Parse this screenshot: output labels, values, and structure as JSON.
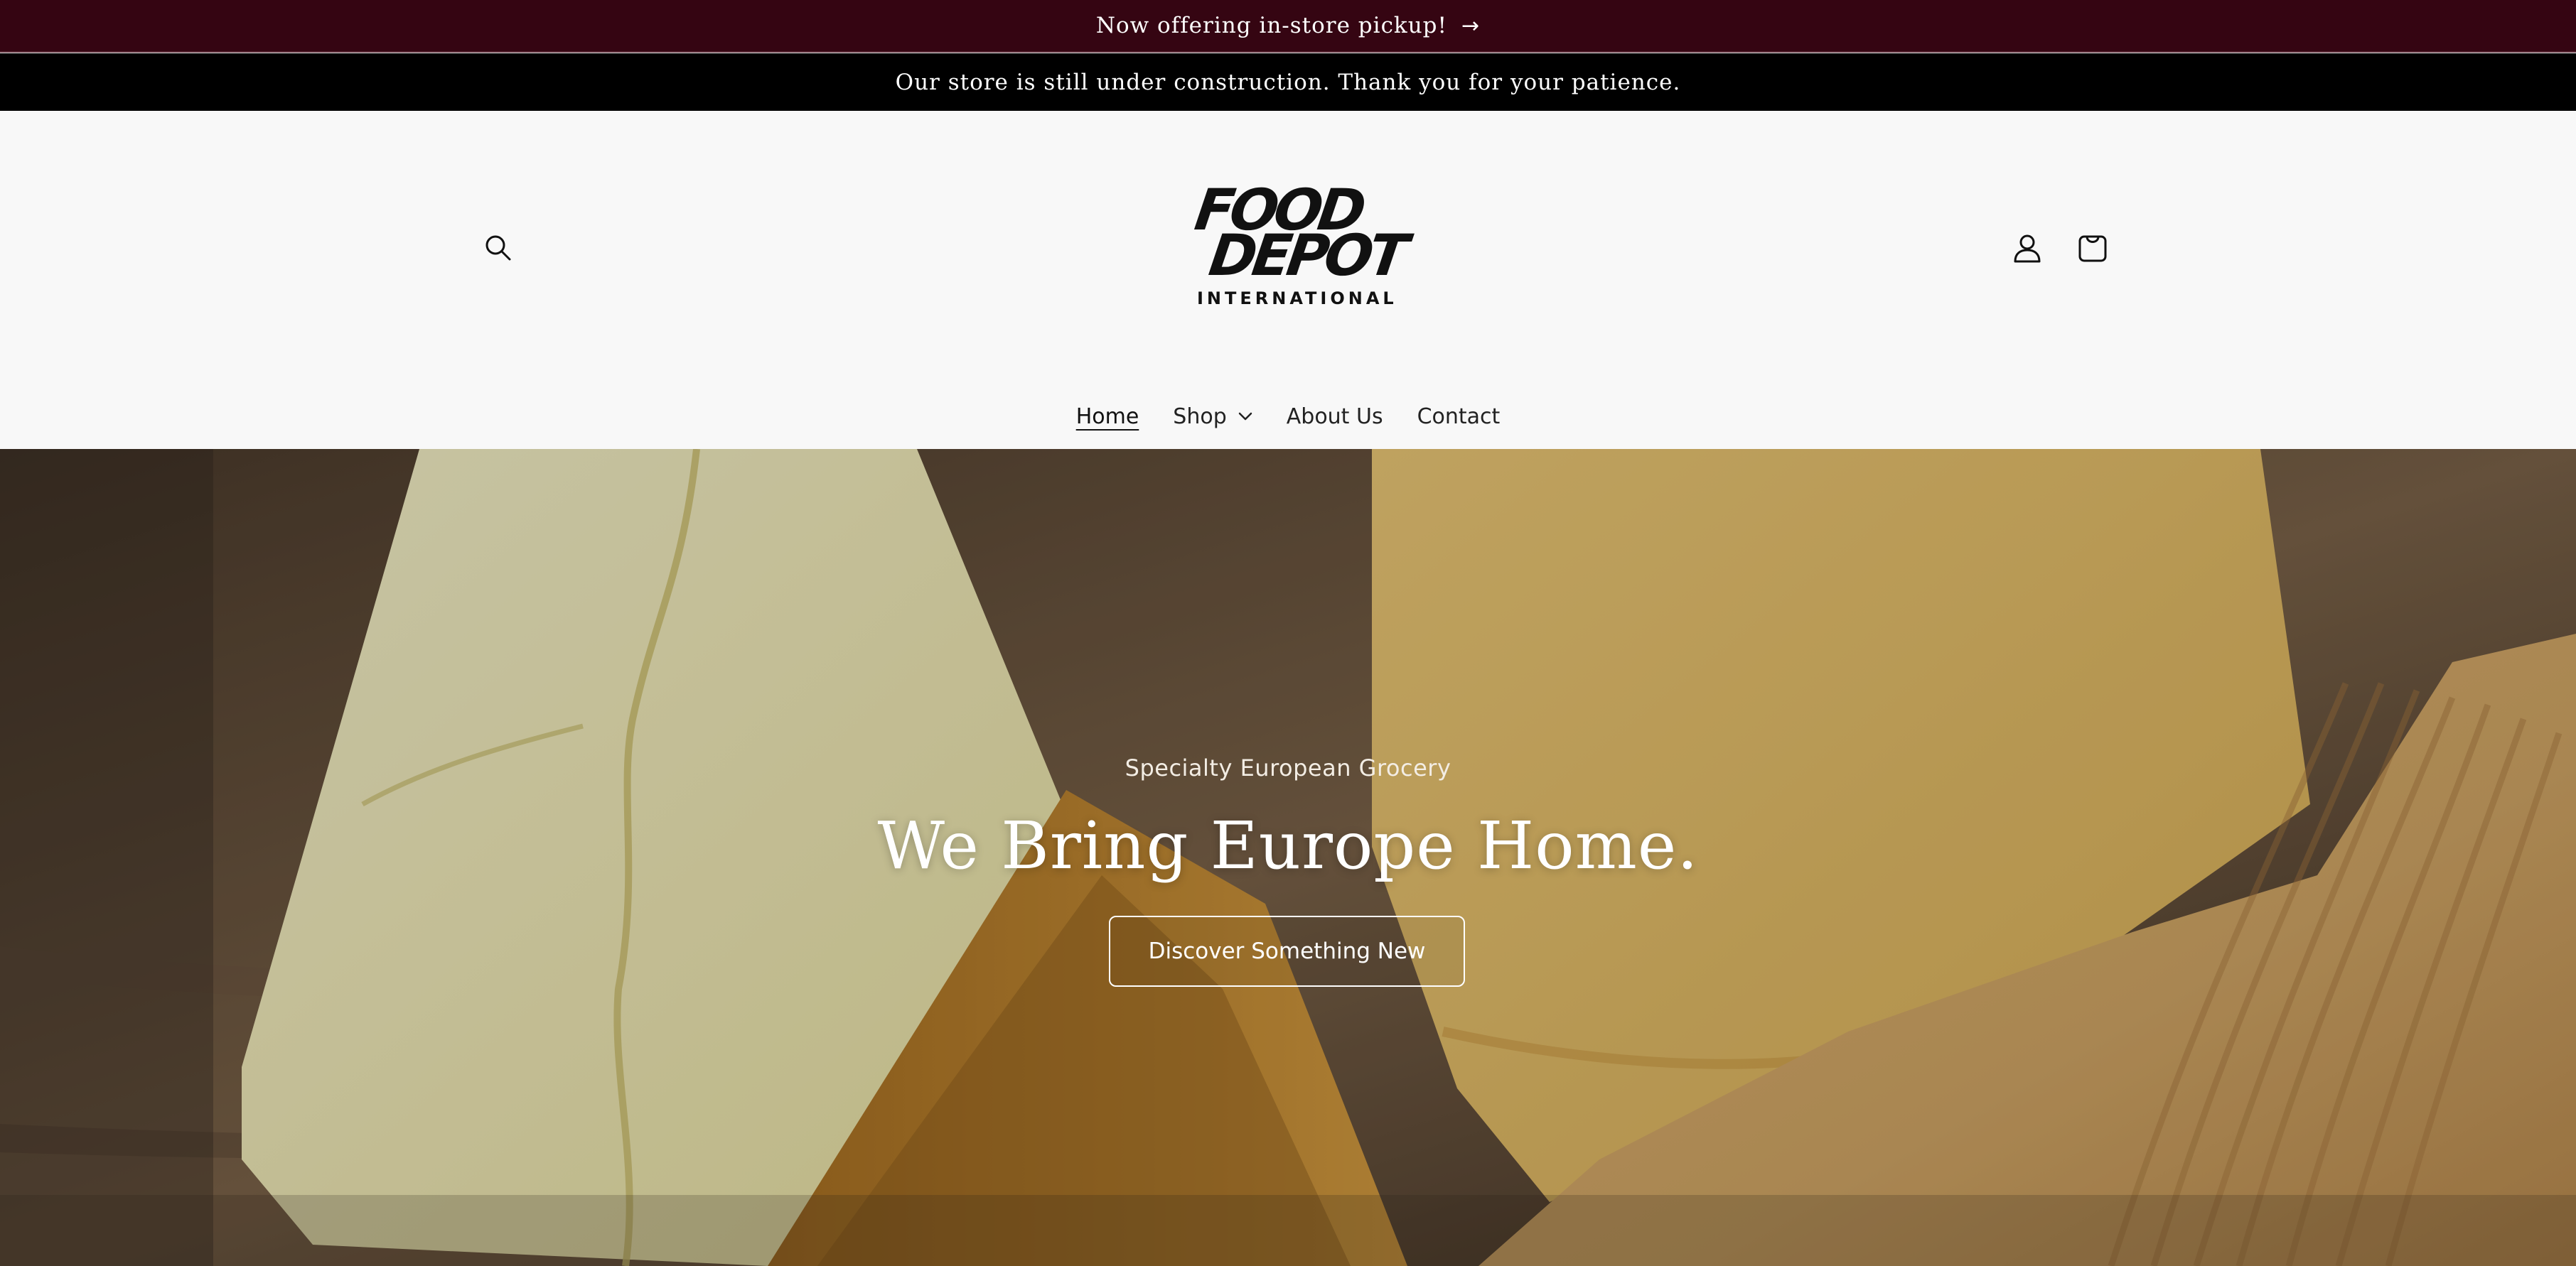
{
  "announcements": {
    "primary": {
      "text": "Now offering in-store pickup!",
      "arrow": "→",
      "background": "#350512"
    },
    "secondary": {
      "text": "Our store is still under construction. Thank you for your patience.",
      "background": "#000000"
    }
  },
  "header": {
    "logo": {
      "line_1": "FOOD",
      "line_2": "DEPOT",
      "line_3": "INTERNATIONAL"
    },
    "icons": {
      "search": "search-icon",
      "account": "account-icon",
      "cart": "cart-icon"
    }
  },
  "nav": {
    "items": [
      {
        "label": "Home",
        "active": true
      },
      {
        "label": "Shop",
        "has_dropdown": true
      },
      {
        "label": "About Us"
      },
      {
        "label": "Contact"
      }
    ]
  },
  "hero": {
    "subtitle": "Specialty European Grocery",
    "title": "We Bring Europe Home.",
    "button_label": "Discover Something New"
  }
}
